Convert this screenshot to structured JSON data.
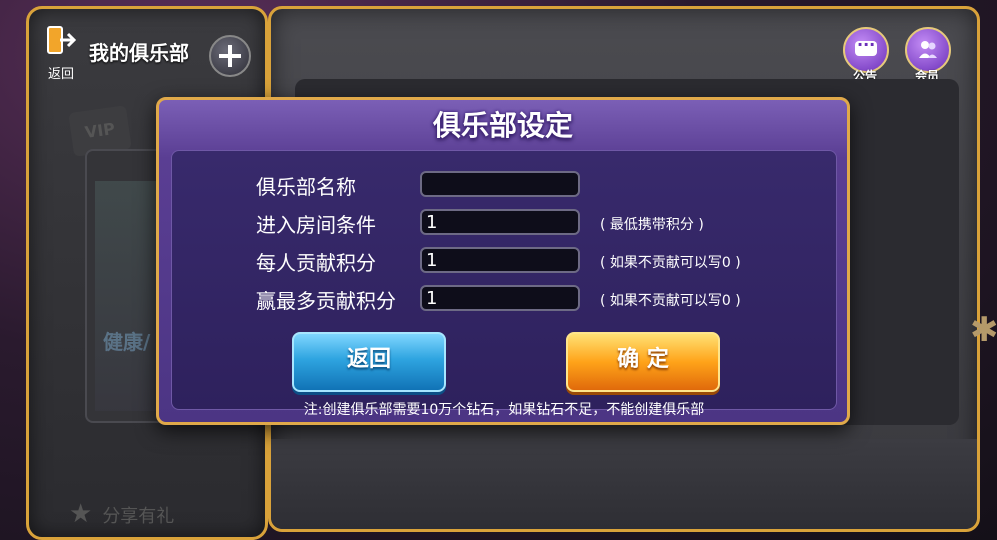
{
  "left_panel": {
    "back_label": "返回",
    "title": "我的俱乐部",
    "vip_label": "VIP",
    "card_text": "健康/",
    "share_label": "分享有礼"
  },
  "top_icons": {
    "notice_label": "公告",
    "member_label": "会员"
  },
  "modal": {
    "title": "俱乐部设定",
    "fields": [
      {
        "label": "俱乐部名称",
        "value": "",
        "hint": ""
      },
      {
        "label": "进入房间条件",
        "value": "1",
        "hint": "( 最低携带积分 )"
      },
      {
        "label": "每人贡献积分",
        "value": "1",
        "hint": "( 如果不贡献可以写0 )"
      },
      {
        "label": "赢最多贡献积分",
        "value": "1",
        "hint": "( 如果不贡献可以写0 )"
      }
    ],
    "back_button": "返回",
    "ok_button": "确 定",
    "note": "注:创建俱乐部需要10万个钻石，如果钻石不足，不能创建俱乐部"
  }
}
